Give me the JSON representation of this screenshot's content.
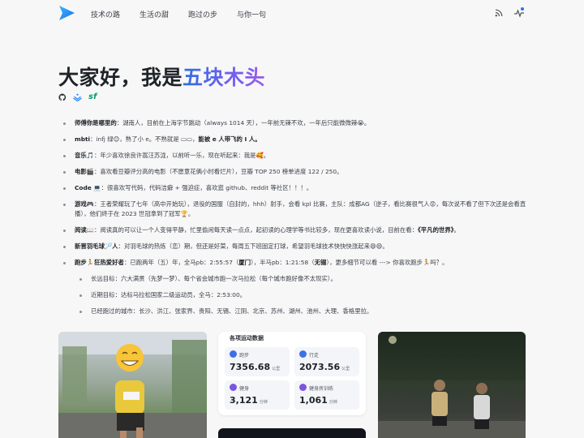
{
  "nav": {
    "links": [
      "技术の路",
      "生活の甜",
      "跑过の步",
      "与你一句"
    ],
    "icons": [
      "logo-icon",
      "rss-icon",
      "pulse-icon"
    ],
    "accent": "#2f6df6"
  },
  "hero": {
    "prefix": "大家好，我是",
    "highlight": "五块木头"
  },
  "social": {
    "sf_label": "sf"
  },
  "intro": [
    {
      "label": "师傅你是哪里的",
      "text": "：湖南人，目前在上海字节跳动（always 1014 天），一年前无辣不欢，一年后只能微微辣😭。"
    },
    {
      "label": "mbti",
      "text": "：infj 绿😊，熟了小 e。不熟就是 ▭▭，",
      "tail": "能被 e 人带飞的 I 人。"
    },
    {
      "label": "音乐🎵",
      "text": "：年少喜欢徐良许嵩汪苏泷，以前听一乐，现在听起来：我是🥰。"
    },
    {
      "label": "电影🎬",
      "text": "：喜欢看豆瓣评分高的电影（不愿意花俩小时看烂片），豆瓣 TOP 250 榜单进度 122 / 250。"
    },
    {
      "label": "Code 💻",
      "text": "：很喜欢写代码，代码洁癖 + 强迫症，喜欢逛 github、reddit 等社区！！！。"
    },
    {
      "label": "游戏🎮",
      "text": "：王者荣耀玩了七年（高中开始玩），退役的国服（自封的，hhh）射手，会看 kpl 比赛，主队：成都AG（逆子，看比赛很气人😡，每次说不看了但下次还是会看直播），他们终于在 2023 世冠拿到了冠军🏆。"
    },
    {
      "label": "阅读📖",
      "text": "：阅读真的可以让一个人变得平静，忙里偷闲每天读一点点，起初读的心理学等书比较多，现在更喜欢读小说，目前在看：",
      "tail": "《平凡的世界》",
      "end": "。"
    },
    {
      "label": "新晋羽毛球🏸人",
      "text": "：对羽毛球的热炼（恋）期，但还是好菜，每周五下班固定打球，希望羽毛球技术快快快涨起来😄😄。"
    },
    {
      "label": "跑步🏃狂热爱好者",
      "text": "：已跑两年（五）年，全马pb：2:55:57（",
      "b1": "厦门",
      "t2": "），半马pb：1:21:58（",
      "b2": "无锡",
      "t3": "），更多细节可以看 ---> 你喜欢跑步🏃吗？。"
    }
  ],
  "running_sub": [
    "长远目标：六大满贯（先梦一梦）、每个省会城市跑一次马拉松（每个城市跑好像不太现实）。",
    "近期目标：达标马拉松国家二级运动员，全马：2:53:00。",
    "已经跑过的城市：长沙、洪江、张家界、贵阳、无锡、江阴、北京、苏州、湖州、池州、大理、香格里拉。"
  ],
  "stats": {
    "title": "各项运动数据",
    "items": [
      {
        "label": "跑步",
        "value": "7356.68",
        "unit": "公里",
        "color": "#3d6fe6"
      },
      {
        "label": "行走",
        "value": "2073.56",
        "unit": "公里",
        "color": "#3d6fe6"
      },
      {
        "label": "健身",
        "value": "3,121",
        "unit": "分钟",
        "color": "#7a56e0"
      },
      {
        "label": "健身房训练",
        "value": "1,061",
        "unit": "分钟",
        "color": "#7a56e0"
      }
    ]
  }
}
